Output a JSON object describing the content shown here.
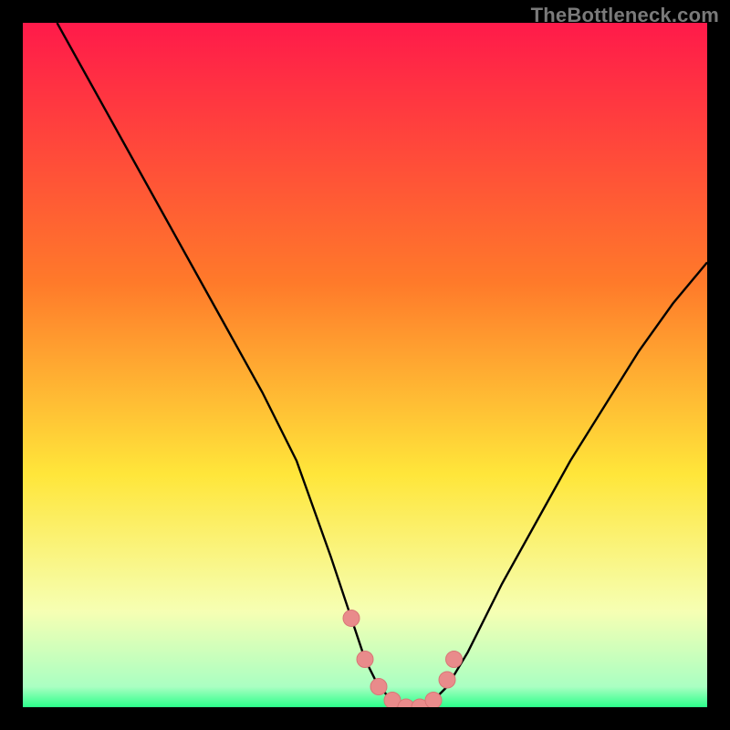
{
  "watermark": "TheBottleneck.com",
  "colors": {
    "frame": "#000000",
    "gradient_top": "#ff1a4a",
    "gradient_mid1": "#ff7a2a",
    "gradient_mid2": "#ffe63a",
    "gradient_band": "#f6ffb3",
    "gradient_bottom": "#2bff8a",
    "curve": "#000000",
    "marker_fill": "#e98b8b",
    "marker_stroke": "#d87676"
  },
  "chart_data": {
    "type": "line",
    "title": "",
    "xlabel": "",
    "ylabel": "",
    "xlim": [
      0,
      100
    ],
    "ylim": [
      0,
      100
    ],
    "note": "Bottleneck curve. Y ~ bottleneck % (0 at minimum). Minimum near x≈55. Axes unlabeled in source; x/y values are estimated pixel-proportional percentages.",
    "series": [
      {
        "name": "bottleneck-curve",
        "x": [
          5,
          10,
          15,
          20,
          25,
          30,
          35,
          40,
          45,
          48,
          50,
          52,
          54,
          56,
          58,
          60,
          62,
          65,
          70,
          75,
          80,
          85,
          90,
          95,
          100
        ],
        "y": [
          100,
          91,
          82,
          73,
          64,
          55,
          46,
          36,
          22,
          13,
          7,
          3,
          1,
          0,
          0,
          1,
          3,
          8,
          18,
          27,
          36,
          44,
          52,
          59,
          65
        ]
      }
    ],
    "markers": {
      "name": "highlight-points",
      "x": [
        48,
        50,
        52,
        54,
        56,
        58,
        60,
        62,
        63
      ],
      "y": [
        13,
        7,
        3,
        1,
        0,
        0,
        1,
        4,
        7
      ]
    }
  }
}
